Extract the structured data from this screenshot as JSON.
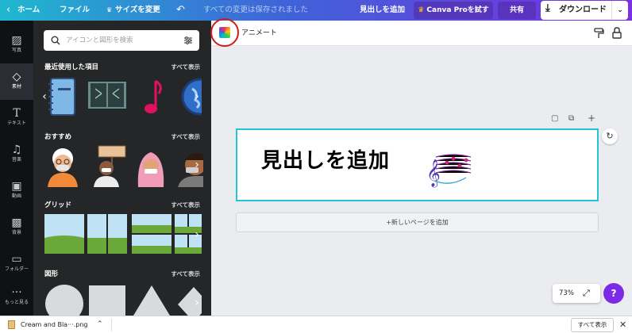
{
  "topbar": {
    "home_label": "ホーム",
    "file_label": "ファイル",
    "resize_label": "サイズを変更",
    "saved_status": "すべての変更は保存されました",
    "add_heading_label": "見出しを追加",
    "canva_pro_label": "Canva Proを試す",
    "share_label": "共有",
    "download_label": "ダウンロード"
  },
  "rail": {
    "items": [
      {
        "label": "写真",
        "icon": "photo-icon"
      },
      {
        "label": "素材",
        "icon": "elements-icon"
      },
      {
        "label": "テキスト",
        "icon": "text-icon"
      },
      {
        "label": "音楽",
        "icon": "music-icon"
      },
      {
        "label": "動画",
        "icon": "video-icon"
      },
      {
        "label": "背景",
        "icon": "background-icon"
      },
      {
        "label": "フォルダー",
        "icon": "folder-icon"
      },
      {
        "label": "もっと見る",
        "icon": "more-icon"
      }
    ]
  },
  "panel": {
    "search_placeholder": "アイコンと図形を検索",
    "sections": [
      {
        "title": "最近使用した項目",
        "see_all": "すべて表示"
      },
      {
        "title": "おすすめ",
        "see_all": "すべて表示"
      },
      {
        "title": "グリッド",
        "see_all": "すべて表示"
      },
      {
        "title": "図形",
        "see_all": "すべて表示"
      }
    ]
  },
  "editor": {
    "animate_label": "アニメート",
    "heading_text": "見出しを追加",
    "add_page_label": "+新しいページを追加",
    "zoom_value": "73%",
    "help_label": "?"
  },
  "downloads": {
    "file_name": "Cream and Bla···.png",
    "show_all_label": "すべて表示"
  },
  "colors": {
    "accent_purple": "#7d2ae8",
    "selection_cyan": "#22c6d6",
    "rail_bg": "#0f1114",
    "panel_bg": "#252627"
  }
}
